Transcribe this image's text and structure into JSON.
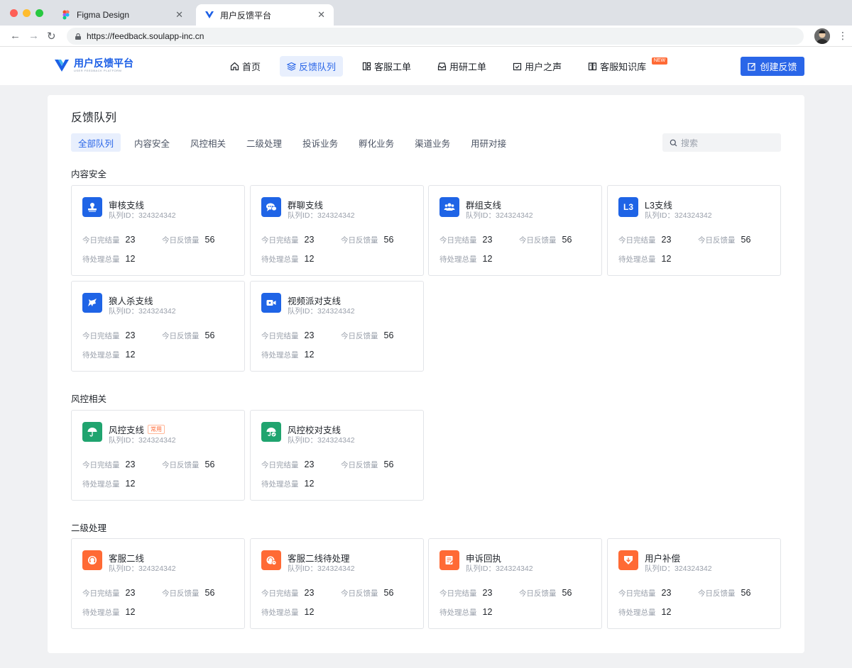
{
  "browser": {
    "tabs": [
      {
        "title": "Figma Design",
        "close": "✕"
      },
      {
        "title": "用户反馈平台",
        "close": "✕"
      }
    ],
    "url": "https://feedback.soulapp-inc.cn",
    "back": "←",
    "forward": "→",
    "reload": "↻",
    "menu": "⋮"
  },
  "app": {
    "logo_title": "用户反馈平台",
    "logo_subtitle": "USER FEEDBACK PLATFORM",
    "nav": [
      {
        "label": "首页",
        "icon": "home-icon"
      },
      {
        "label": "反馈队列",
        "icon": "layers-icon",
        "active": true
      },
      {
        "label": "客服工单",
        "icon": "grid-icon"
      },
      {
        "label": "用研工单",
        "icon": "inbox-icon"
      },
      {
        "label": "用户之声",
        "icon": "calendar-check-icon"
      },
      {
        "label": "客服知识库",
        "icon": "book-icon",
        "badge": "NEW"
      }
    ],
    "create_button": "创建反馈"
  },
  "main": {
    "title": "反馈队列",
    "filters": [
      "全部队列",
      "内容安全",
      "风控相关",
      "二级处理",
      "投诉业务",
      "孵化业务",
      "渠道业务",
      "用研对接"
    ],
    "search_placeholder": "搜索",
    "stat_labels": {
      "done": "今日完结量",
      "feedback": "今日反馈量",
      "pending": "待处理总量"
    },
    "sections": [
      {
        "title": "内容安全",
        "cards": [
          {
            "name": "审核支线",
            "id": "队列ID：324324342",
            "done": "23",
            "feedback": "56",
            "pending": "12",
            "icon": "stamp-icon",
            "color": "blue"
          },
          {
            "name": "群聊支线",
            "id": "队列ID：324324342",
            "done": "23",
            "feedback": "56",
            "pending": "12",
            "icon": "chat-icon",
            "color": "blue"
          },
          {
            "name": "群组支线",
            "id": "队列ID：324324342",
            "done": "23",
            "feedback": "56",
            "pending": "12",
            "icon": "group-icon",
            "color": "blue"
          },
          {
            "name": "L3支线",
            "id": "队列ID：324324342",
            "done": "23",
            "feedback": "56",
            "pending": "12",
            "icon": "l3-icon",
            "icon_text": "L3",
            "color": "blue"
          },
          {
            "name": "狼人杀支线",
            "id": "队列ID：324324342",
            "done": "23",
            "feedback": "56",
            "pending": "12",
            "icon": "wolf-icon",
            "color": "blue"
          },
          {
            "name": "视频派对支线",
            "id": "队列ID：324324342",
            "done": "23",
            "feedback": "56",
            "pending": "12",
            "icon": "video-icon",
            "color": "blue"
          }
        ]
      },
      {
        "title": "风控相关",
        "cards": [
          {
            "name": "风控支线",
            "tag": "常用",
            "id": "队列ID：324324342",
            "done": "23",
            "feedback": "56",
            "pending": "12",
            "icon": "umbrella-icon",
            "color": "green"
          },
          {
            "name": "风控校对支线",
            "id": "队列ID：324324342",
            "done": "23",
            "feedback": "56",
            "pending": "12",
            "icon": "umbrella-check-icon",
            "color": "green"
          }
        ]
      },
      {
        "title": "二级处理",
        "cards": [
          {
            "name": "客服二线",
            "id": "队列ID：324324342",
            "done": "23",
            "feedback": "56",
            "pending": "12",
            "icon": "headset-icon",
            "color": "orange"
          },
          {
            "name": "客服二线待处理",
            "id": "队列ID：324324342",
            "done": "23",
            "feedback": "56",
            "pending": "12",
            "icon": "headset-clock-icon",
            "color": "orange"
          },
          {
            "name": "申诉回执",
            "id": "队列ID：324324342",
            "done": "23",
            "feedback": "56",
            "pending": "12",
            "icon": "document-edit-icon",
            "color": "orange"
          },
          {
            "name": "用户补偿",
            "id": "队列ID：324324342",
            "done": "23",
            "feedback": "56",
            "pending": "12",
            "icon": "gift-down-icon",
            "color": "orange"
          }
        ]
      }
    ]
  }
}
